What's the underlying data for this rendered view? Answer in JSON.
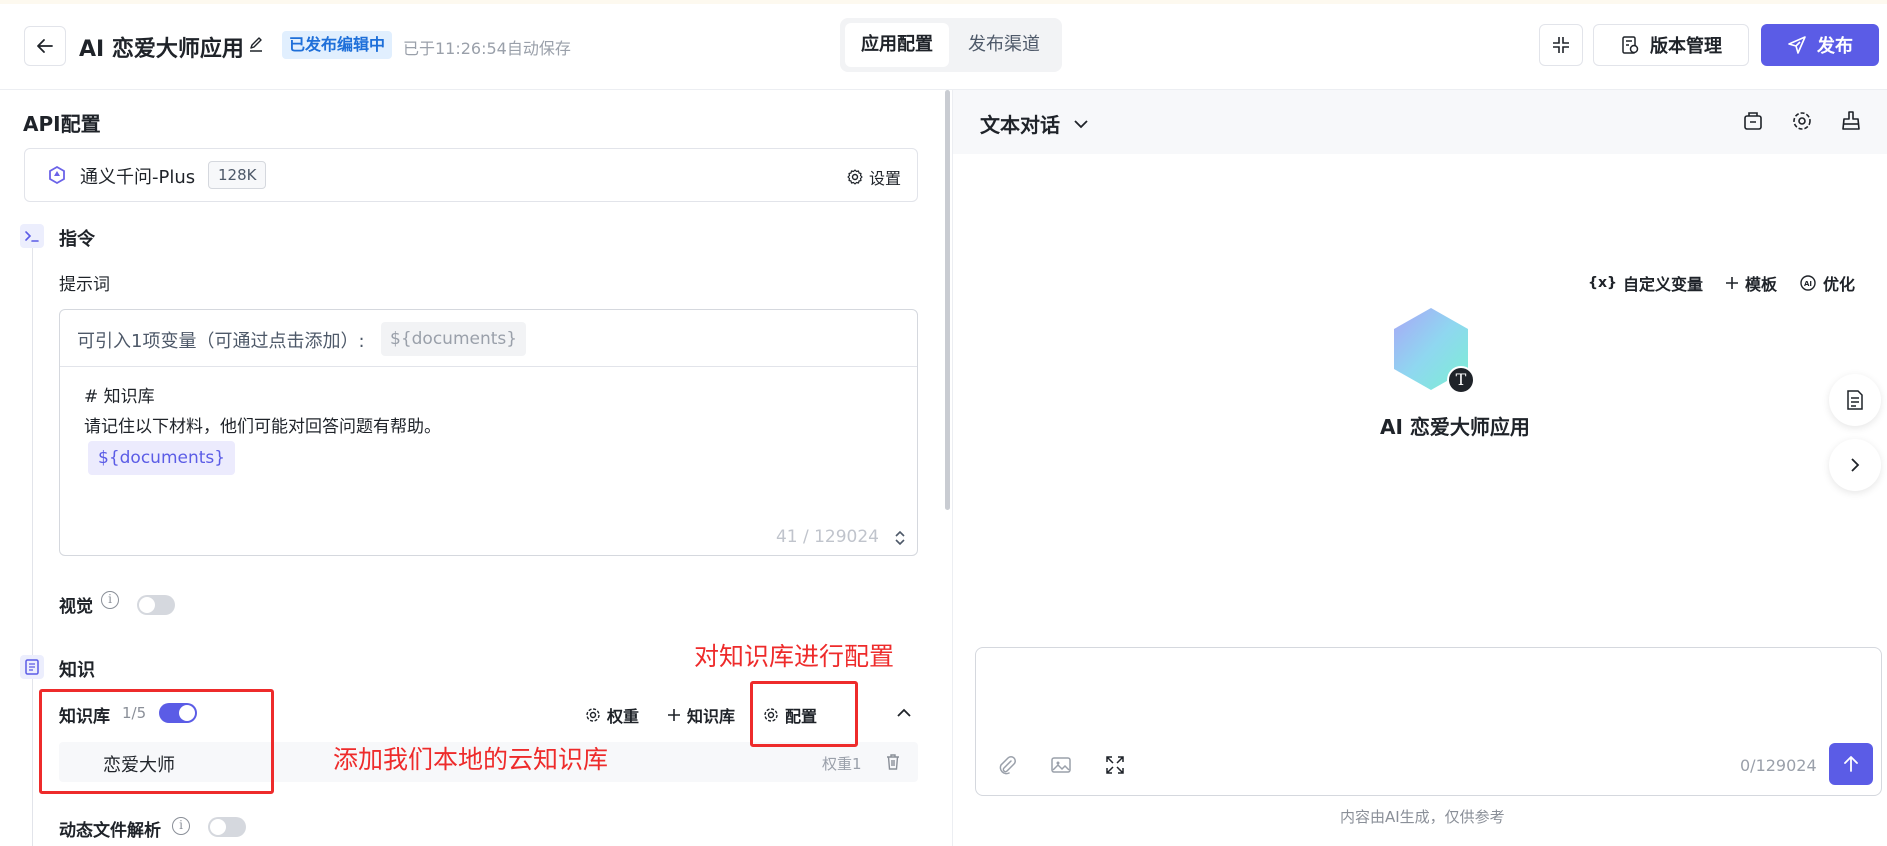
{
  "header": {
    "app_title": "AI 恋爱大师应用",
    "status_badge": "已发布编辑中",
    "autosave": "已于11:26:54自动保存",
    "tabs": [
      {
        "label": "应用配置",
        "active": true
      },
      {
        "label": "发布渠道",
        "active": false
      }
    ],
    "version_label": "版本管理",
    "publish_label": "发布"
  },
  "api": {
    "section_title": "API配置",
    "model_name": "通义千问-Plus",
    "context_badge": "128K",
    "settings_label": "设置"
  },
  "instruction": {
    "section_title": "指令",
    "prompt_label": "提示词",
    "tools": {
      "custom_var": "自定义变量",
      "template": "模板",
      "optimize": "优化"
    },
    "hint": "可引入1项变量（可通过点击添加）:",
    "var_chip": "${documents}",
    "body_line1": "# 知识库",
    "body_line2": "请记住以下材料，他们可能对回答问题有帮助。",
    "doc_chip": "${documents}",
    "char_count": "41 / 129024"
  },
  "vision": {
    "label": "视觉",
    "enabled": false
  },
  "knowledge": {
    "section_title": "知识",
    "kb_label": "知识库",
    "kb_count": "1/5",
    "kb_enabled": true,
    "tools": {
      "weight": "权重",
      "add": "知识库",
      "config": "配置"
    },
    "items": [
      {
        "name": "恋爱大师",
        "weight": "权重1"
      }
    ],
    "dynamic_label": "动态文件解析",
    "dynamic_enabled": false
  },
  "annotations": {
    "config_note": "对知识库进行配置",
    "add_note": "添加我们本地的云知识库",
    "color": "#ee2b2b"
  },
  "chat": {
    "mode": "文本对话",
    "bot_name": "AI 恋爱大师应用",
    "avatar_badge": "T",
    "input_count": "0/129024",
    "disclaimer": "内容由AI生成，仅供参考"
  },
  "colors": {
    "accent": "#5b5ce6",
    "badge_bg": "#e1effe",
    "badge_text": "#1e6fd9"
  }
}
